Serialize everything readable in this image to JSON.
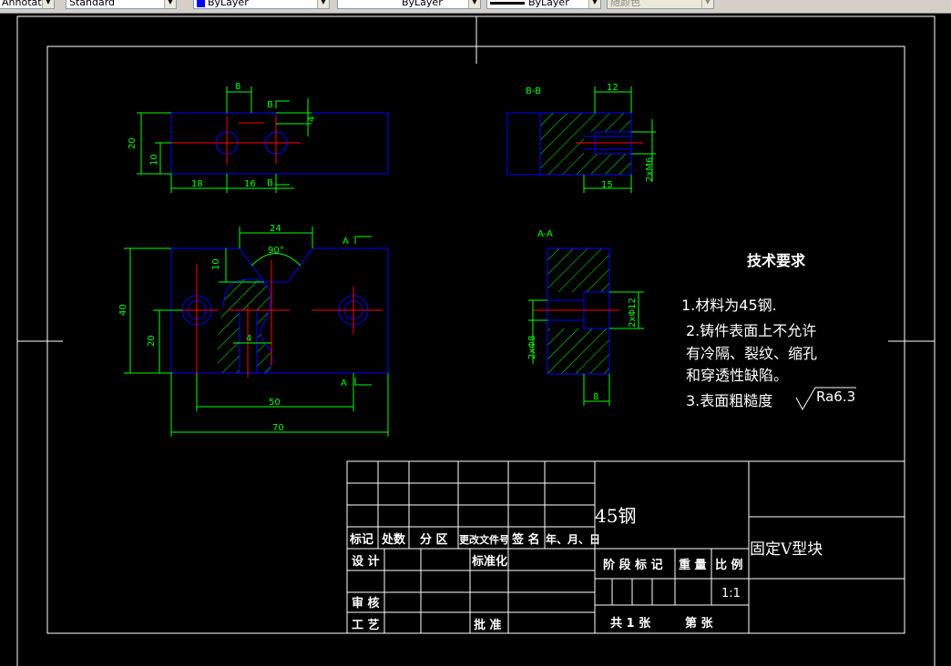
{
  "toolbar": {
    "style_select": "Annotative",
    "dim_style_select": "Standard",
    "layer_color_select": "ByLayer",
    "linetype_select": "ByLayer",
    "lineweight_select": "ByLayer",
    "plot_style_select": "随颜色"
  },
  "colors": {
    "background": "#000000",
    "object": "#0000ff",
    "dimension": "#00ff00",
    "center": "#ff0000",
    "text": "#ffffff"
  },
  "views": {
    "top": {
      "dims": [
        "8",
        "4",
        "20",
        "10",
        "18",
        "16"
      ],
      "section_mark_top": "B",
      "section_mark_bottom": "B"
    },
    "section_bb": {
      "label": "B-B",
      "dims": [
        "12",
        "15",
        "2xM6"
      ]
    },
    "front": {
      "dims": [
        "24",
        "90°",
        "10",
        "40",
        "20",
        "4",
        "50",
        "70"
      ],
      "section_mark_top": "A",
      "section_mark_bottom": "A"
    },
    "section_aa": {
      "label": "A-A",
      "dims": [
        "2xΦ12",
        "2xΦ8",
        "8"
      ]
    }
  },
  "tech": {
    "title": "技术要求",
    "lines": [
      "1.材料为45钢.",
      "2.铸件表面上不允许",
      "有冷隔、裂纹、缩孔",
      "和穿透性缺陷。",
      "3.表面粗糙度"
    ],
    "roughness": "Ra6.3"
  },
  "title_block": {
    "material": "45钢",
    "part_name": "固定V型块",
    "header_cells": [
      "标记",
      "处数",
      "分 区",
      "更改文件号",
      "签 名",
      "年、月、日"
    ],
    "design": "设 计",
    "standardize": "标准化",
    "review": "审 核",
    "process": "工 艺",
    "approve": "批 准",
    "stage_mark": "阶 段 标 记",
    "weight": "重 量",
    "scale_label": "比 例",
    "scale_value": "1:1",
    "sheets_total": "共 1  张",
    "sheet_no": "第     张"
  }
}
